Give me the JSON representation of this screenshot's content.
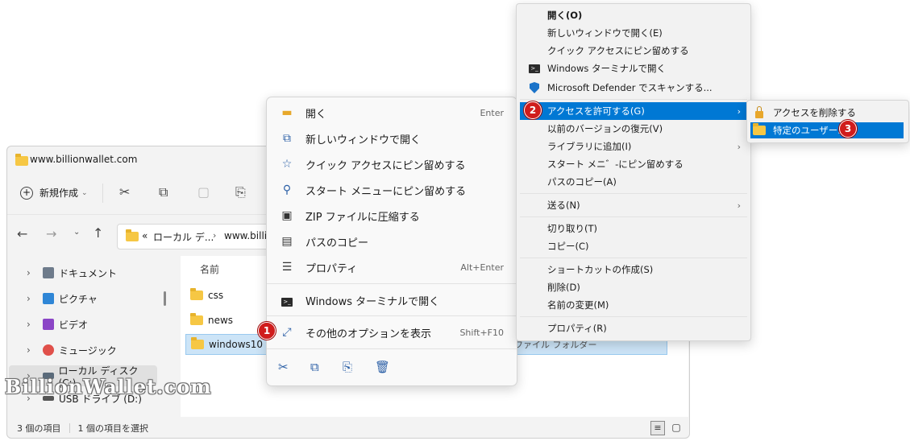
{
  "explorer": {
    "title": "www.billionwallet.com",
    "toolbar": {
      "new_label": "新規作成"
    },
    "address": {
      "prefix": "«",
      "crumb1": "ローカル デ...",
      "crumb2": "www.billion"
    },
    "nav_items": [
      {
        "label": "ドキュメント"
      },
      {
        "label": "ピクチャ"
      },
      {
        "label": "ビデオ"
      },
      {
        "label": "ミュージック"
      },
      {
        "label": "ローカル ディスク (C:)"
      },
      {
        "label": "USB ドライブ (D:)"
      }
    ],
    "column_name": "名前",
    "files": [
      {
        "name": "css"
      },
      {
        "name": "news"
      },
      {
        "name": "windows10"
      }
    ],
    "file_type_text": "ファイル フォルダー",
    "status": {
      "items": "3 個の項目",
      "selected": "1 個の項目を選択"
    }
  },
  "menu1": {
    "items": [
      {
        "label": "開く",
        "shortcut": "Enter"
      },
      {
        "label": "新しいウィンドウで開く",
        "shortcut": ""
      },
      {
        "label": "クイック アクセスにピン留めする",
        "shortcut": ""
      },
      {
        "label": "スタート メニューにピン留めする",
        "shortcut": ""
      },
      {
        "label": "ZIP ファイルに圧縮する",
        "shortcut": ""
      },
      {
        "label": "パスのコピー",
        "shortcut": ""
      },
      {
        "label": "プロパティ",
        "shortcut": "Alt+Enter"
      },
      {
        "label": "Windows ターミナルで開く",
        "shortcut": ""
      },
      {
        "label": "その他のオプションを表示",
        "shortcut": "Shift+F10"
      }
    ]
  },
  "menu2": {
    "items": [
      {
        "label": "開く(O)"
      },
      {
        "label": "新しいウィンドウで開く(E)"
      },
      {
        "label": "クイック アクセスにピン留めする"
      },
      {
        "label": "Windows ターミナルで開く"
      },
      {
        "label": "Microsoft Defender でスキャンする..."
      },
      {
        "label": "アクセスを許可する(G)"
      },
      {
        "label": "以前のバージョンの復元(V)"
      },
      {
        "label": "ライブラリに追加(I)"
      },
      {
        "label": "スタート メニ゛-にピン留めする"
      },
      {
        "label": "パスのコピー(A)"
      },
      {
        "label": "送る(N)"
      },
      {
        "label": "切り取り(T)"
      },
      {
        "label": "コピー(C)"
      },
      {
        "label": "ショートカットの作成(S)"
      },
      {
        "label": "削除(D)"
      },
      {
        "label": "名前の変更(M)"
      },
      {
        "label": "プロパティ(R)"
      }
    ]
  },
  "menu3": {
    "items": [
      {
        "label": "アクセスを削除する"
      },
      {
        "label": "特定のユーザー..."
      }
    ]
  },
  "badges": {
    "b1": "1",
    "b2": "2",
    "b3": "3"
  },
  "watermark": "BillionWallet.com",
  "colors": {
    "accent": "#0078d4",
    "badge": "#d01c1c",
    "folder": "#f6c744"
  }
}
